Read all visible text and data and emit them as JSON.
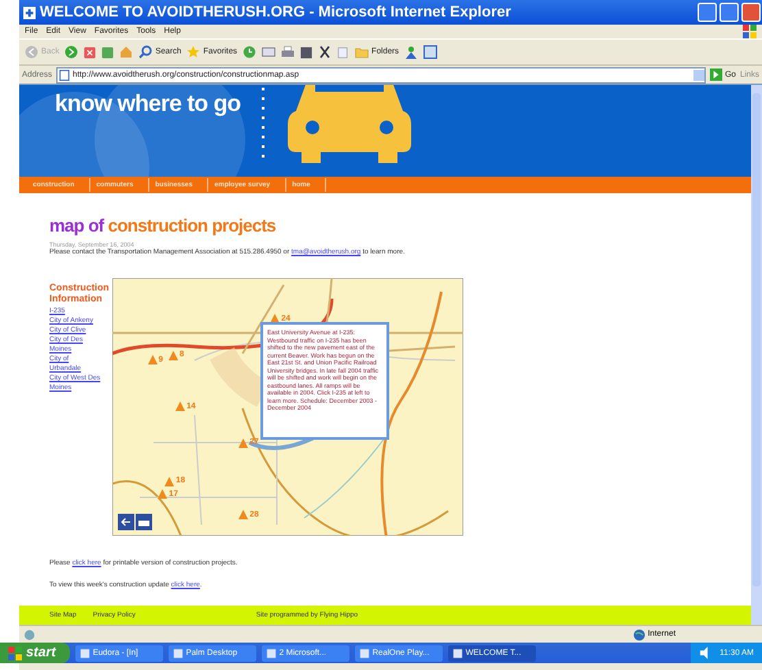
{
  "window": {
    "title": "WELCOME TO AVOIDTHERUSH.ORG - Microsoft Internet Explorer"
  },
  "menu": [
    "File",
    "Edit",
    "View",
    "Favorites",
    "Tools",
    "Help"
  ],
  "toolbar": [
    {
      "kind": "back",
      "label": "Back",
      "disabled": true
    },
    {
      "kind": "search",
      "label": "Search",
      "disabled": false
    },
    {
      "kind": "favorites",
      "label": "Favorites",
      "disabled": false
    },
    {
      "kind": "folders",
      "label": "Folders",
      "disabled": false
    }
  ],
  "address_bar": {
    "label": "Address",
    "value": "http://www.avoidtherush.org/construction/constructionmap.asp",
    "go": "Go",
    "links": "Links"
  },
  "banner": {
    "slogan": "know where to go"
  },
  "nav": [
    "construction",
    "commuters",
    "businesses",
    "employee survey",
    "home"
  ],
  "heading": {
    "lead": "map of",
    "main": "construction projects"
  },
  "date": "Thursday, September 16, 2004",
  "contact": {
    "before": "Please contact the Transportation Management Association at 515.286.4950 or",
    "link": "tma@avoidtherush.org",
    "after": "to learn more."
  },
  "sidebar": {
    "title": "Construction Information",
    "links": [
      "I-235",
      "City of Ankeny",
      "City of Clive",
      "City of Des Moines",
      "City of Urbandale",
      "City of West Des Moines"
    ]
  },
  "map": {
    "markers": [
      {
        "label": "24"
      },
      {
        "label": "9"
      },
      {
        "label": "8"
      },
      {
        "label": "14"
      },
      {
        "label": "27"
      },
      {
        "label": "18"
      },
      {
        "label": "17"
      },
      {
        "label": "28"
      }
    ],
    "popup": "East University Avenue at I-235: Westbound traffic on I-235 has been shifted to the new pavement east of the current Beaver. Work has begun on the East 21st St. and Union Pacific Railroad University bridges. In late fall 2004 traffic will be shifted and work will begin on the eastbound lanes. All ramps will be available in 2004. Click I-235 at left to learn more. Schedule: December 2003 - December 2004"
  },
  "printable": {
    "before": "Please",
    "link": "click here",
    "after": "for printable version of construction projects."
  },
  "update": {
    "before": "To view this week's construction update",
    "link": "click here",
    "after": "."
  },
  "footer": {
    "links": [
      "Site Map",
      "Privacy Policy"
    ],
    "credit": "Site programmed by Flying Hippo"
  },
  "status_bar": {
    "zone": "Internet"
  },
  "taskbar": {
    "start": "start",
    "tasks": [
      {
        "label": "Eudora - [In]",
        "selected": false
      },
      {
        "label": "Palm Desktop",
        "selected": false
      },
      {
        "label": "2 Microsoft...",
        "selected": false
      },
      {
        "label": "RealOne Play...",
        "selected": false
      },
      {
        "label": "WELCOME T...",
        "selected": true
      }
    ],
    "clock": "11:30 AM"
  }
}
